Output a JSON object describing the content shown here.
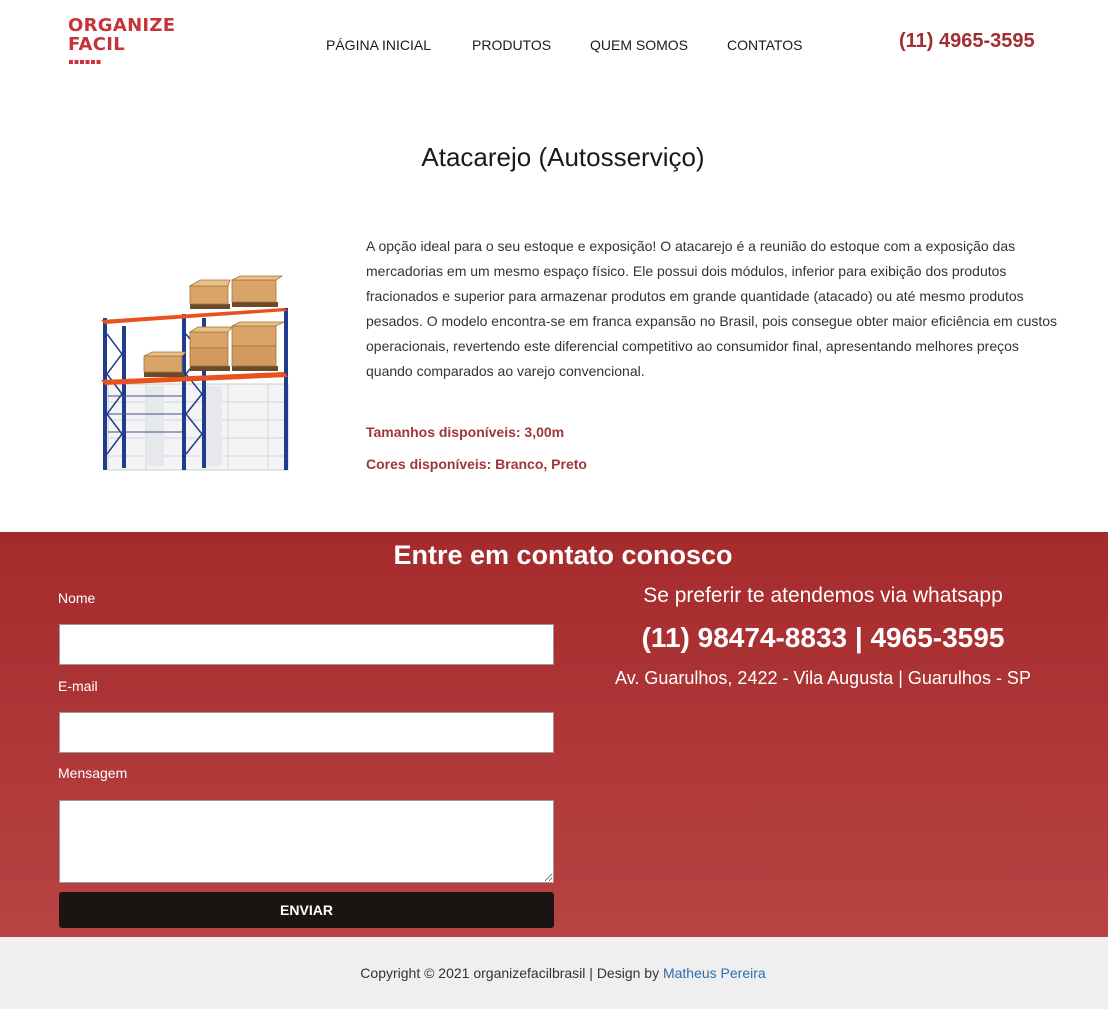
{
  "header": {
    "logo": {
      "line1": "ORGANIZE",
      "line2": "FACIL"
    },
    "nav": [
      {
        "label": "PÁGINA INICIAL"
      },
      {
        "label": "PRODUTOS"
      },
      {
        "label": "QUEM SOMOS"
      },
      {
        "label": "CONTATOS"
      }
    ],
    "phone": "(11) 4965-3595"
  },
  "product": {
    "title": "Atacarejo (Autosserviço)",
    "description": "A opção ideal para o seu estoque e exposição! O atacarejo é a reunião do estoque com a exposição das mercadorias em um mesmo espaço físico. Ele possui dois módulos, inferior para exibição dos produtos fracionados e superior para armazenar produtos em grande quantidade (atacado) ou até mesmo produtos pesados. O modelo encontra-se em franca expansão no Brasil, pois consegue obter maior eficiência em custos operacionais, revertendo este diferencial competitivo ao consumidor final, apresentando melhores preços quando comparados ao varejo convencional.",
    "sizes": "Tamanhos disponíveis: 3,00m",
    "colors": "Cores disponíveis: Branco, Preto"
  },
  "contact": {
    "title": "Entre em contato conosco",
    "fields": {
      "name_label": "Nome",
      "email_label": "E-mail",
      "message_label": "Mensagem"
    },
    "submit_label": "ENVIAR",
    "whatsapp_text": "Se preferir te atendemos via whatsapp",
    "phones": "(11) 98474-8833 | 4965-3595",
    "address": "Av. Guarulhos, 2422 - Vila Augusta | Guarulhos - SP"
  },
  "footer": {
    "copyright": "Copyright © 2021 organizefacilbrasil | Design by ",
    "designer": "Matheus Pereira"
  },
  "colors": {
    "brand_red": "#c8333a",
    "contact_band": "#a52a2c",
    "spec_text": "#a0363a",
    "button_dark": "#1a1413",
    "footer_bg": "#efefef",
    "link": "#2f6db0"
  }
}
